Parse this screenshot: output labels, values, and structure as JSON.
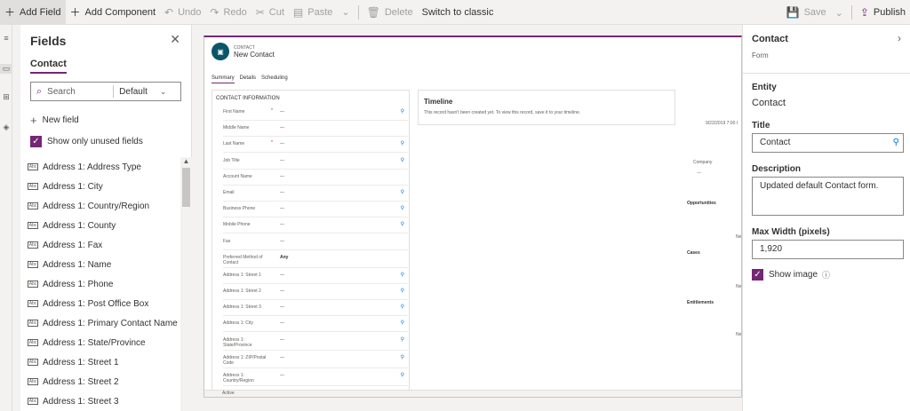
{
  "toolbar": {
    "add_field": "Add Field",
    "add_component": "Add Component",
    "undo": "Undo",
    "redo": "Redo",
    "cut": "Cut",
    "paste": "Paste",
    "delete": "Delete",
    "switch_classic": "Switch to classic",
    "save": "Save",
    "publish": "Publish"
  },
  "fields_panel": {
    "title": "Fields",
    "tab": "Contact",
    "search_placeholder": "Search",
    "filter_value": "Default",
    "new_field": "New field",
    "show_unused": "Show only unused fields",
    "items": [
      "Address 1: Address Type",
      "Address 1: City",
      "Address 1: Country/Region",
      "Address 1: County",
      "Address 1: Fax",
      "Address 1: Name",
      "Address 1: Phone",
      "Address 1: Post Office Box",
      "Address 1: Primary Contact Name",
      "Address 1: State/Province",
      "Address 1: Street 1",
      "Address 1: Street 2",
      "Address 1: Street 3"
    ]
  },
  "form": {
    "entity_label": "CONTACT",
    "record_title": "New Contact",
    "tabs": [
      "Summary",
      "Details",
      "Scheduling"
    ],
    "section_title": "CONTACT INFORMATION",
    "rows": [
      {
        "label": "First Name",
        "req": "*",
        "value": "---"
      },
      {
        "label": "Middle Name",
        "req": "",
        "value": "---"
      },
      {
        "label": "Last Name",
        "req": "*",
        "value": "---"
      },
      {
        "label": "Job Title",
        "req": "",
        "value": "---"
      },
      {
        "label": "Account Name",
        "req": "",
        "value": "---"
      },
      {
        "label": "Email",
        "req": "",
        "value": "---"
      },
      {
        "label": "Business Phone",
        "req": "",
        "value": "---"
      },
      {
        "label": "Mobile Phone",
        "req": "",
        "value": "---"
      },
      {
        "label": "Fax",
        "req": "",
        "value": "---"
      },
      {
        "label": "Preferred Method of Contact",
        "req": "",
        "value": "Any"
      },
      {
        "label": "Address 1: Street 1",
        "req": "",
        "value": "---"
      },
      {
        "label": "Address 1: Street 2",
        "req": "",
        "value": "---"
      },
      {
        "label": "Address 1: Street 3",
        "req": "",
        "value": "---"
      },
      {
        "label": "Address 1: City",
        "req": "",
        "value": "---"
      },
      {
        "label": "Address 1: State/Province",
        "req": "",
        "value": "---"
      },
      {
        "label": "Address 1: ZIP/Postal Code",
        "req": "",
        "value": "---"
      },
      {
        "label": "Address 1: Country/Region",
        "req": "",
        "value": "---"
      }
    ],
    "timeline_title": "Timeline",
    "timeline_desc": "This record hasn't been created yet.  To view this record, save it to your timeline.",
    "right_date": "9/22/2019 7:00 I",
    "company_label": "Company",
    "company_value": "---",
    "opportunities": "Opportunities",
    "cases": "Cases",
    "entitlements": "Entitlements",
    "ne": "Ne",
    "status": "Active"
  },
  "props": {
    "title": "Contact",
    "subtitle": "Form",
    "entity_label": "Entity",
    "entity_value": "Contact",
    "title_label": "Title",
    "title_value": "Contact",
    "desc_label": "Description",
    "desc_value": "Updated default Contact form.",
    "maxw_label": "Max Width (pixels)",
    "maxw_value": "1,920",
    "show_image": "Show image"
  },
  "colors": {
    "accent": "#742774",
    "avatar": "#0b556a",
    "link": "#0078d4"
  }
}
